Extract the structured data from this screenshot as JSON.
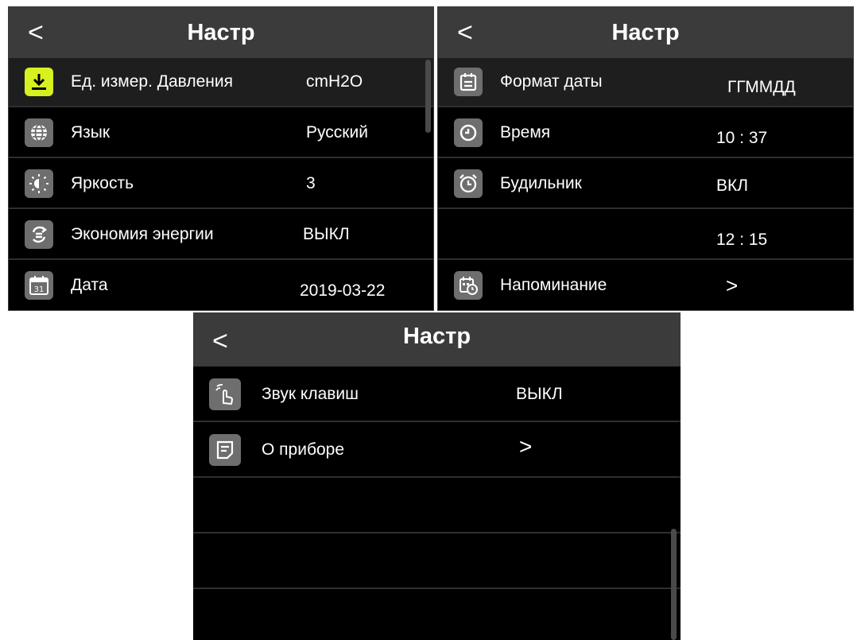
{
  "panel1": {
    "back": "<",
    "title": "Настр",
    "rows": [
      {
        "icon": "download-icon",
        "label": "Ед. измер. Давления",
        "value": "cmH2O"
      },
      {
        "icon": "globe-icon",
        "label": "Язык",
        "value": "Русский"
      },
      {
        "icon": "brightness-icon",
        "label": "Яркость",
        "value": "3"
      },
      {
        "icon": "power-saving-icon",
        "label": "Экономия энергии",
        "value": "ВЫКЛ"
      },
      {
        "icon": "calendar-31-icon",
        "label": "Дата",
        "value": "2019-03-22",
        "icon_text": "31"
      }
    ]
  },
  "panel2": {
    "back": "<",
    "title": "Настр",
    "rows": [
      {
        "icon": "calendar-icon",
        "label": "Формат даты",
        "value": "ГГММДД"
      },
      {
        "icon": "clock-icon",
        "label": "Время",
        "value": "10 : 37"
      },
      {
        "icon": "alarm-clock-icon",
        "label": "Будильник",
        "value": "ВКЛ"
      },
      {
        "icon": "",
        "label": "",
        "value": "12 : 15"
      },
      {
        "icon": "reminder-calendar-icon",
        "label": "Напоминание",
        "value": ">"
      }
    ]
  },
  "panel3": {
    "back": "<",
    "title": "Настр",
    "rows": [
      {
        "icon": "touch-sound-icon",
        "label": "Звук клавиш",
        "value": "ВЫКЛ"
      },
      {
        "icon": "document-icon",
        "label": "О приборе",
        "value": ">"
      }
    ]
  },
  "colors": {
    "background": "#000000",
    "header": "#3b3b3b",
    "accent": "#d7f020",
    "divider": "#2f2f2f",
    "icon_bg": "#6e6e6e"
  }
}
